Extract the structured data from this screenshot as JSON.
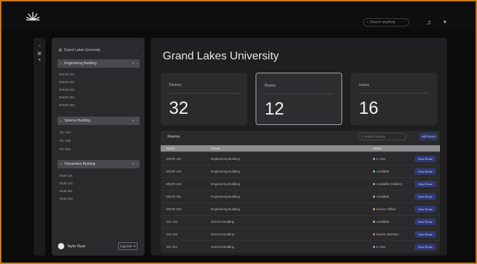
{
  "header": {
    "search_placeholder": "Search anything",
    "logo_icon": "sunburst-logo",
    "bell_icon": "bell-icon",
    "user_icon": "user-icon"
  },
  "rail": {
    "icons": [
      "home-icon",
      "grid-icon",
      "user-icon"
    ]
  },
  "sidebar": {
    "title": "Grand Lakes University",
    "buildings": [
      {
        "name": "Engineering Building",
        "rooms": [
          "ENGR 101",
          "ENGR 102",
          "ENGR 103",
          "ENGR 201",
          "ENGR 202"
        ]
      },
      {
        "name": "Science Building",
        "rooms": [
          "SCI 101",
          "SCI 102",
          "SCI 201"
        ]
      },
      {
        "name": "Humanities Building",
        "rooms": [
          "HUM 101",
          "HUM 102",
          "HUM 201",
          "HUM 202"
        ]
      }
    ],
    "user_name": "Taylor Ryan",
    "logout_label": "Log Out"
  },
  "main": {
    "title": "Grand Lakes University",
    "cards": [
      {
        "label": "Devices",
        "value": "32"
      },
      {
        "label": "Rooms",
        "value": "12"
      },
      {
        "label": "Issues",
        "value": "16"
      }
    ],
    "panel_title": "Rooms",
    "search_placeholder": "Search Rooms",
    "add_label": "Add Room",
    "columns": [
      "Name",
      "Group",
      "Status"
    ],
    "rows": [
      {
        "name": "ENGR 101",
        "group": "Engineering Building",
        "status": "In Use",
        "status_color": "#9aa0ff"
      },
      {
        "name": "ENGR 102",
        "group": "Engineering Building",
        "status": "Available",
        "status_color": "#7fd18b"
      },
      {
        "name": "ENGR 103",
        "group": "Engineering Building",
        "status": "Available (Hidden)",
        "status_color": "#7fd18b"
      },
      {
        "name": "ENGR 201",
        "group": "Engineering Building",
        "status": "Available",
        "status_color": "#7fd18b"
      },
      {
        "name": "ENGR 202",
        "group": "Engineering Building",
        "status": "Device Offline",
        "status_color": "#e0b060"
      },
      {
        "name": "SCI 101",
        "group": "Science Building",
        "status": "Available",
        "status_color": "#7fd18b"
      },
      {
        "name": "SCI 102",
        "group": "Science Building",
        "status": "Needs Attention",
        "status_color": "#e07a6a"
      },
      {
        "name": "SCI 201",
        "group": "Science Building",
        "status": "In Use",
        "status_color": "#9aa0ff"
      }
    ],
    "view_label": "View Room"
  },
  "colors": {
    "accent": "#2e3a78",
    "frame": "#c97a14",
    "panel": "#2a2a2d"
  }
}
